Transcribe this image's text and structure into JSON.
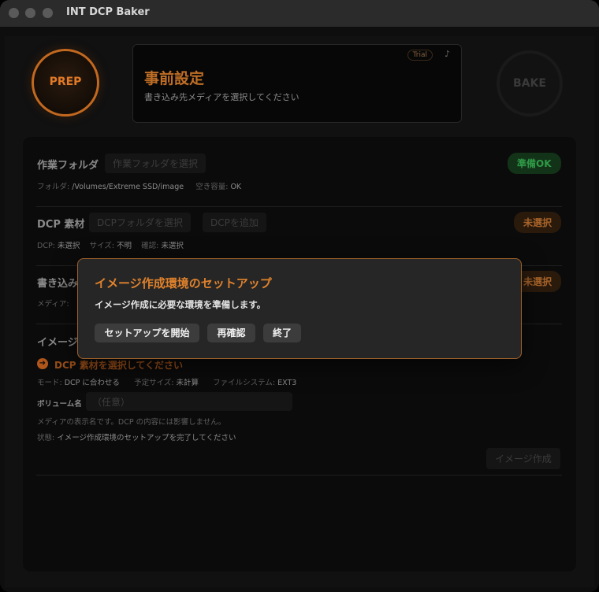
{
  "window": {
    "title": "INT DCP Baker"
  },
  "header": {
    "prep_label": "PREP",
    "bake_label": "BAKE",
    "title": "事前設定",
    "subtitle": "書き込み先メディアを選択してください",
    "trial_badge": "Trial",
    "note_icon": "music-note-icon"
  },
  "work_folder": {
    "label": "作業フォルダ",
    "select_button": "作業フォルダを選択",
    "status_pill": "準備OK",
    "folder_key": "フォルダ:",
    "folder_value": "/Volumes/Extreme SSD/image",
    "space_key": "空き容量:",
    "space_value": "OK"
  },
  "dcp_material": {
    "label": "DCP 素材",
    "select_button": "DCPフォルダを選択",
    "add_button": "DCPを追加",
    "status_pill": "未選択",
    "dcp_key": "DCP:",
    "dcp_value": "未選択",
    "size_key": "サイズ:",
    "size_value": "不明",
    "check_key": "確認:",
    "check_value": "未選択"
  },
  "write_target": {
    "label": "書き込み先",
    "status_pill": "未選択",
    "media_key": "メディア:"
  },
  "image_section": {
    "label": "イメージ",
    "hint": "DCP 素材を選択してください",
    "mode_key": "モード:",
    "mode_value": "DCP に合わせる",
    "size_key": "予定サイズ:",
    "size_value": "未計算",
    "fs_key": "ファイルシステム:",
    "fs_value": "EXT3",
    "volume_label": "ボリューム名",
    "volume_placeholder": "（任意）",
    "volume_help": "メディアの表示名です。DCP の内容には影響しません。",
    "state_key": "状態:",
    "state_value": "イメージ作成環境のセットアップを完了してください",
    "create_button": "イメージ作成"
  },
  "modal": {
    "title": "イメージ作成環境のセットアップ",
    "message": "イメージ作成に必要な環境を準備します。",
    "buttons": [
      "セットアップを開始",
      "再確認",
      "終了"
    ]
  },
  "colors": {
    "accent": "#e0822c",
    "ok_green": "#2f9a47",
    "modal_border": "#a0612a"
  }
}
